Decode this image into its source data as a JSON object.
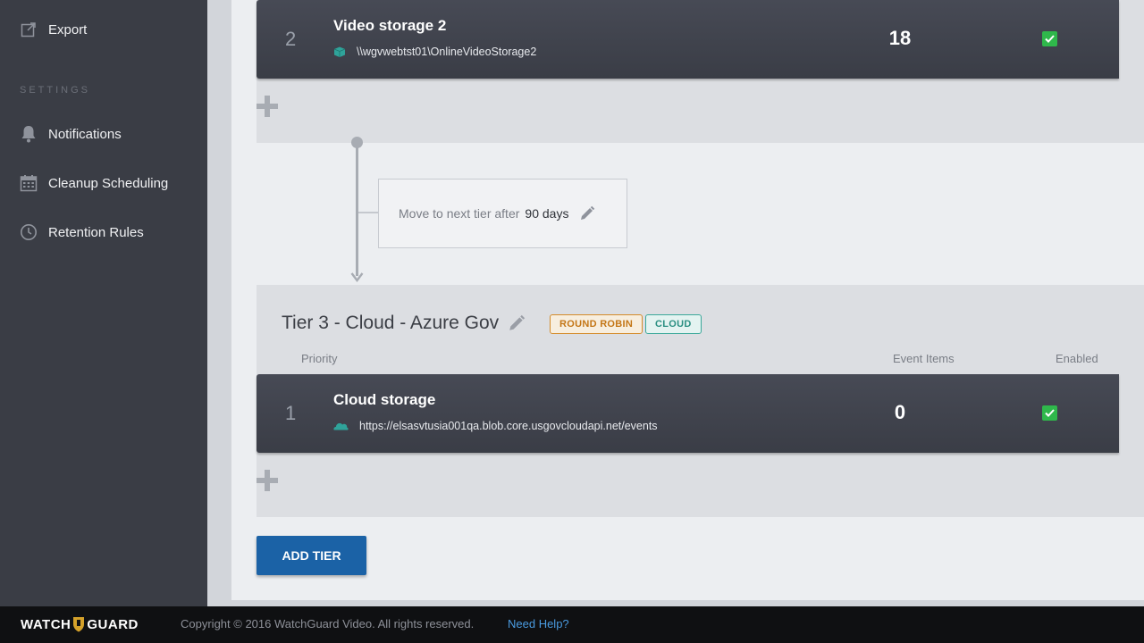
{
  "sidebar": {
    "export_label": "Export",
    "settings_heading": "SETTINGS",
    "items": [
      {
        "label": "Notifications",
        "icon": "bell-icon"
      },
      {
        "label": "Cleanup Scheduling",
        "icon": "calendar-icon"
      },
      {
        "label": "Retention Rules",
        "icon": "clock-icon"
      }
    ]
  },
  "tier2": {
    "row": {
      "priority": "2",
      "name": "Video storage 2",
      "path": "\\\\wgvwebtst01\\OnlineVideoStorage2",
      "event_items": "18",
      "enabled": true
    }
  },
  "transition": {
    "text": "Move to next tier after",
    "days": "90 days"
  },
  "tier3": {
    "title": "Tier 3 - Cloud - Azure Gov",
    "badges": [
      "ROUND ROBIN",
      "CLOUD"
    ],
    "columns": {
      "priority": "Priority",
      "event_items": "Event Items",
      "enabled": "Enabled"
    },
    "row": {
      "priority": "1",
      "name": "Cloud storage",
      "path": "https://elsasvtusia001qa.blob.core.usgovcloudapi.net/events",
      "event_items": "0",
      "enabled": true
    }
  },
  "add_tier_label": "ADD TIER",
  "footer": {
    "logo_left": "WATCH",
    "logo_right": "GUARD",
    "copyright": "Copyright © 2016 WatchGuard Video. All rights reserved.",
    "help": "Need Help?"
  },
  "colors": {
    "sidebar_bg": "#3a3d45",
    "accent_button": "#1b62a6",
    "enabled_green": "#2fb84b",
    "badge_round_robin": "#d48b2a",
    "badge_cloud": "#3aa89a"
  }
}
